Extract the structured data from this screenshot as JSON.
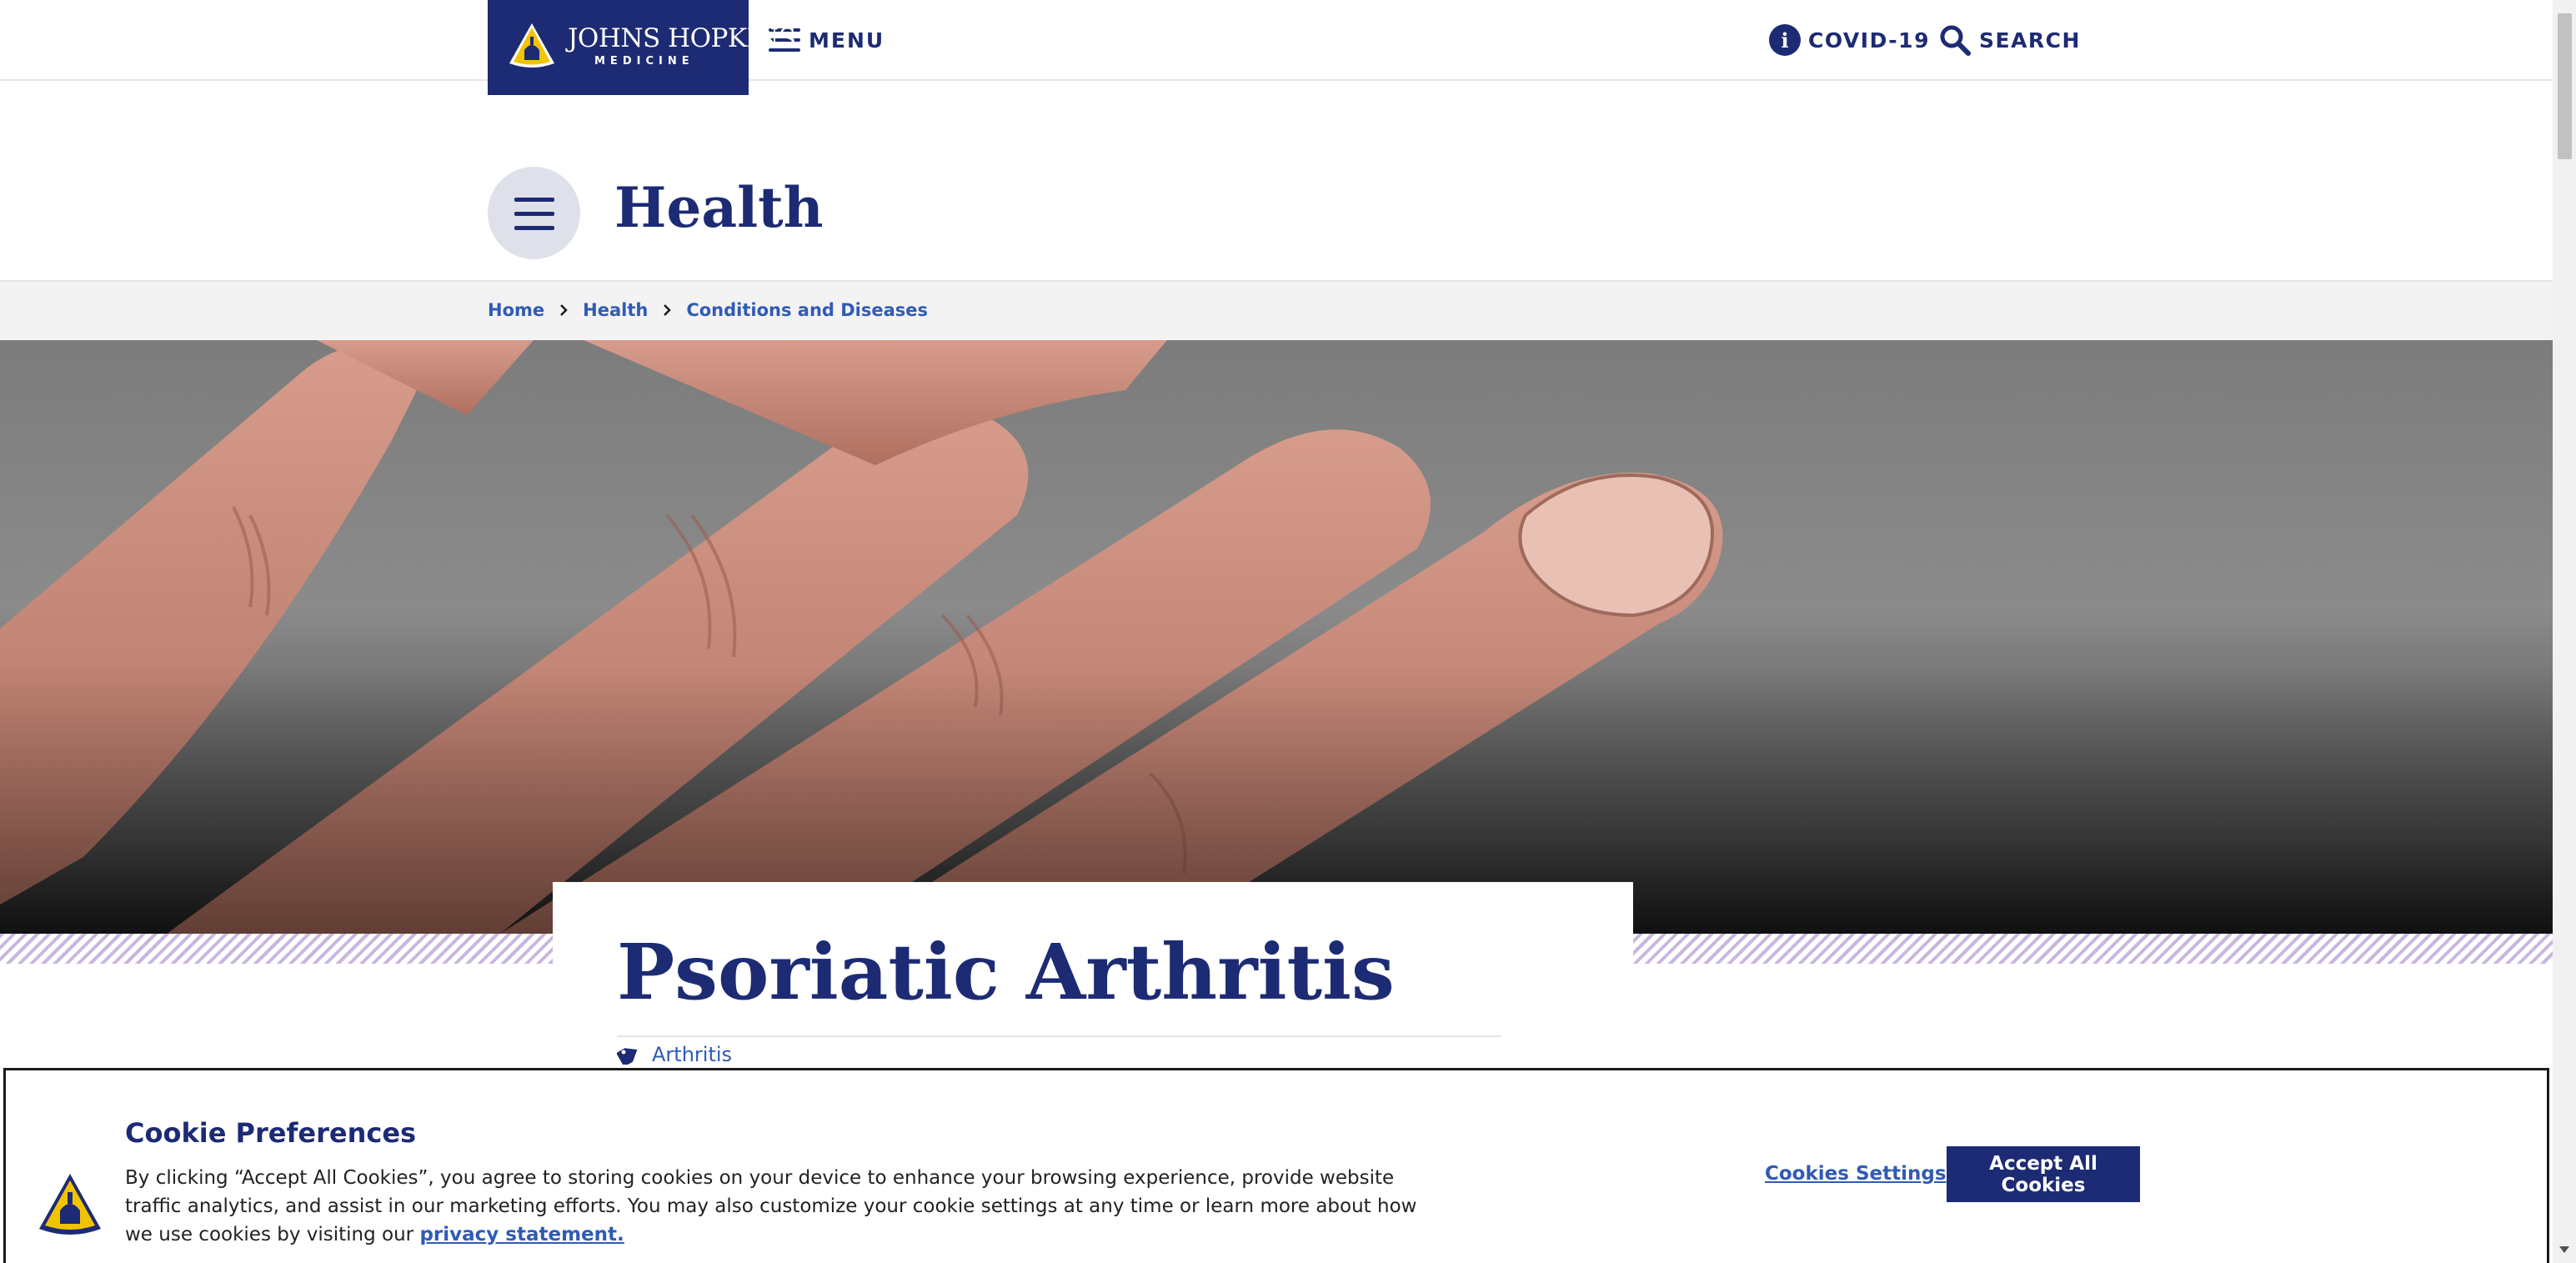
{
  "header": {
    "logo_line1": "JOHNS HOPKINS",
    "logo_line2": "MEDICINE",
    "menu_label": "MENU",
    "covid_icon_glyph": "i",
    "covid_label": "COVID-19",
    "search_label": "SEARCH"
  },
  "section": {
    "title": "Health"
  },
  "breadcrumb": {
    "items": [
      "Home",
      "Health",
      "Conditions and Diseases"
    ]
  },
  "hero": {
    "icon": "hand-photo"
  },
  "article": {
    "title": "Psoriatic Arthritis",
    "tag": "Arthritis"
  },
  "cookie_banner": {
    "title": "Cookie Preferences",
    "text": "By clicking “Accept All Cookies”, you agree to storing cookies on your device to enhance your browsing experience, provide website traffic analytics, and assist in our marketing efforts. You may also customize your cookie settings at any time or learn more about how we use cookies by visiting our",
    "privacy_link": "privacy statement.",
    "settings_label": "Cookies Settings",
    "accept_label": "Accept All Cookies"
  },
  "colors": {
    "brand_navy": "#1d2b74",
    "link_blue": "#2f5bb5",
    "shield_gold": "#f2c400",
    "stripe_lavender": "#c9b7df"
  }
}
